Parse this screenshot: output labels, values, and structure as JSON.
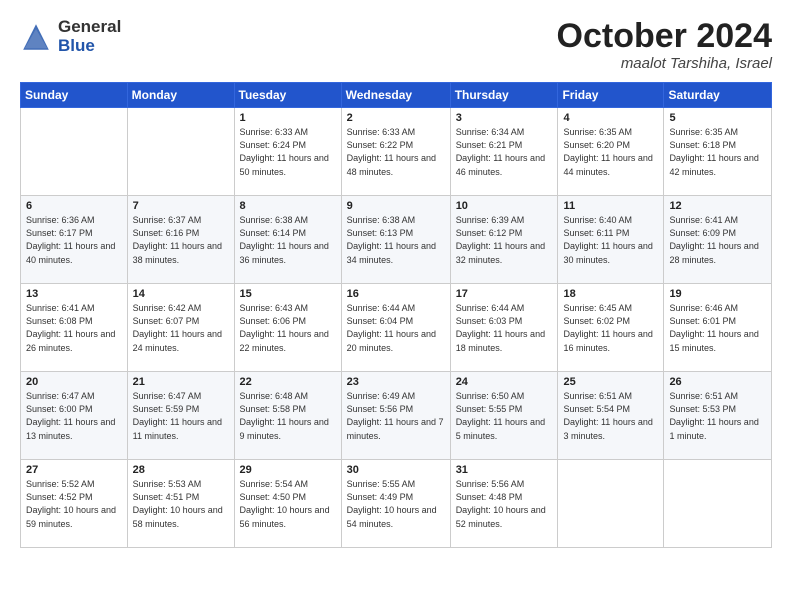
{
  "header": {
    "logo_general": "General",
    "logo_blue": "Blue",
    "title": "October 2024",
    "location": "maalot Tarshiha, Israel"
  },
  "weekdays": [
    "Sunday",
    "Monday",
    "Tuesday",
    "Wednesday",
    "Thursday",
    "Friday",
    "Saturday"
  ],
  "weeks": [
    [
      {
        "day": "",
        "info": ""
      },
      {
        "day": "",
        "info": ""
      },
      {
        "day": "1",
        "info": "Sunrise: 6:33 AM\nSunset: 6:24 PM\nDaylight: 11 hours and 50 minutes."
      },
      {
        "day": "2",
        "info": "Sunrise: 6:33 AM\nSunset: 6:22 PM\nDaylight: 11 hours and 48 minutes."
      },
      {
        "day": "3",
        "info": "Sunrise: 6:34 AM\nSunset: 6:21 PM\nDaylight: 11 hours and 46 minutes."
      },
      {
        "day": "4",
        "info": "Sunrise: 6:35 AM\nSunset: 6:20 PM\nDaylight: 11 hours and 44 minutes."
      },
      {
        "day": "5",
        "info": "Sunrise: 6:35 AM\nSunset: 6:18 PM\nDaylight: 11 hours and 42 minutes."
      }
    ],
    [
      {
        "day": "6",
        "info": "Sunrise: 6:36 AM\nSunset: 6:17 PM\nDaylight: 11 hours and 40 minutes."
      },
      {
        "day": "7",
        "info": "Sunrise: 6:37 AM\nSunset: 6:16 PM\nDaylight: 11 hours and 38 minutes."
      },
      {
        "day": "8",
        "info": "Sunrise: 6:38 AM\nSunset: 6:14 PM\nDaylight: 11 hours and 36 minutes."
      },
      {
        "day": "9",
        "info": "Sunrise: 6:38 AM\nSunset: 6:13 PM\nDaylight: 11 hours and 34 minutes."
      },
      {
        "day": "10",
        "info": "Sunrise: 6:39 AM\nSunset: 6:12 PM\nDaylight: 11 hours and 32 minutes."
      },
      {
        "day": "11",
        "info": "Sunrise: 6:40 AM\nSunset: 6:11 PM\nDaylight: 11 hours and 30 minutes."
      },
      {
        "day": "12",
        "info": "Sunrise: 6:41 AM\nSunset: 6:09 PM\nDaylight: 11 hours and 28 minutes."
      }
    ],
    [
      {
        "day": "13",
        "info": "Sunrise: 6:41 AM\nSunset: 6:08 PM\nDaylight: 11 hours and 26 minutes."
      },
      {
        "day": "14",
        "info": "Sunrise: 6:42 AM\nSunset: 6:07 PM\nDaylight: 11 hours and 24 minutes."
      },
      {
        "day": "15",
        "info": "Sunrise: 6:43 AM\nSunset: 6:06 PM\nDaylight: 11 hours and 22 minutes."
      },
      {
        "day": "16",
        "info": "Sunrise: 6:44 AM\nSunset: 6:04 PM\nDaylight: 11 hours and 20 minutes."
      },
      {
        "day": "17",
        "info": "Sunrise: 6:44 AM\nSunset: 6:03 PM\nDaylight: 11 hours and 18 minutes."
      },
      {
        "day": "18",
        "info": "Sunrise: 6:45 AM\nSunset: 6:02 PM\nDaylight: 11 hours and 16 minutes."
      },
      {
        "day": "19",
        "info": "Sunrise: 6:46 AM\nSunset: 6:01 PM\nDaylight: 11 hours and 15 minutes."
      }
    ],
    [
      {
        "day": "20",
        "info": "Sunrise: 6:47 AM\nSunset: 6:00 PM\nDaylight: 11 hours and 13 minutes."
      },
      {
        "day": "21",
        "info": "Sunrise: 6:47 AM\nSunset: 5:59 PM\nDaylight: 11 hours and 11 minutes."
      },
      {
        "day": "22",
        "info": "Sunrise: 6:48 AM\nSunset: 5:58 PM\nDaylight: 11 hours and 9 minutes."
      },
      {
        "day": "23",
        "info": "Sunrise: 6:49 AM\nSunset: 5:56 PM\nDaylight: 11 hours and 7 minutes."
      },
      {
        "day": "24",
        "info": "Sunrise: 6:50 AM\nSunset: 5:55 PM\nDaylight: 11 hours and 5 minutes."
      },
      {
        "day": "25",
        "info": "Sunrise: 6:51 AM\nSunset: 5:54 PM\nDaylight: 11 hours and 3 minutes."
      },
      {
        "day": "26",
        "info": "Sunrise: 6:51 AM\nSunset: 5:53 PM\nDaylight: 11 hours and 1 minute."
      }
    ],
    [
      {
        "day": "27",
        "info": "Sunrise: 5:52 AM\nSunset: 4:52 PM\nDaylight: 10 hours and 59 minutes."
      },
      {
        "day": "28",
        "info": "Sunrise: 5:53 AM\nSunset: 4:51 PM\nDaylight: 10 hours and 58 minutes."
      },
      {
        "day": "29",
        "info": "Sunrise: 5:54 AM\nSunset: 4:50 PM\nDaylight: 10 hours and 56 minutes."
      },
      {
        "day": "30",
        "info": "Sunrise: 5:55 AM\nSunset: 4:49 PM\nDaylight: 10 hours and 54 minutes."
      },
      {
        "day": "31",
        "info": "Sunrise: 5:56 AM\nSunset: 4:48 PM\nDaylight: 10 hours and 52 minutes."
      },
      {
        "day": "",
        "info": ""
      },
      {
        "day": "",
        "info": ""
      }
    ]
  ]
}
